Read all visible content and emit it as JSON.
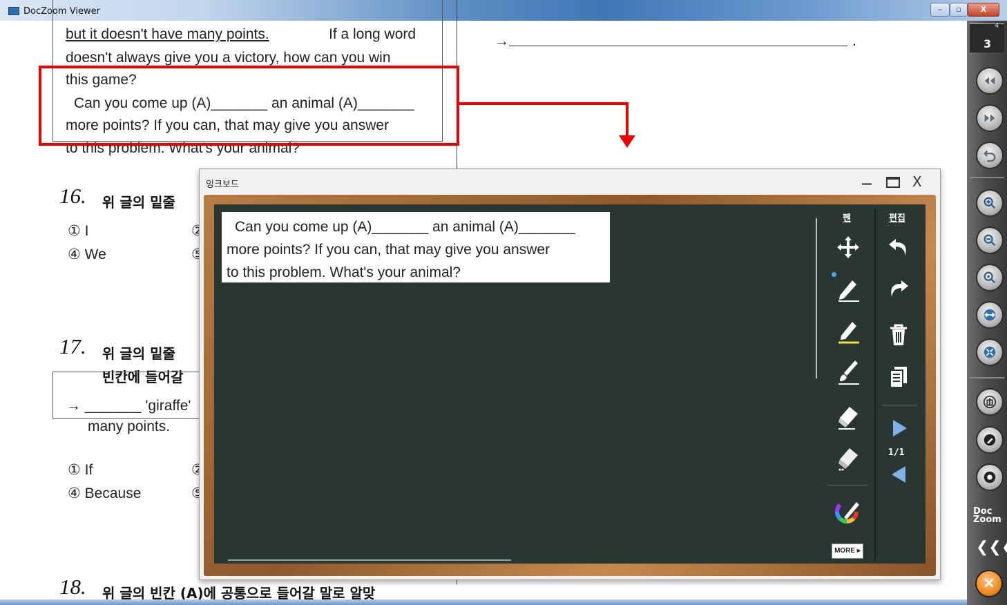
{
  "window": {
    "title": "DocZoom Viewer",
    "min": "▭",
    "max": "◻",
    "close": "X"
  },
  "document": {
    "passage_lines": [
      "but  it  doesn't  have  many  points.",
      "doesn't  always  give  you  a  victory,  how  can  you  win",
      "this  game?",
      "Can  you  come  up  (A)_______  an  animal  (A)_______",
      "more  points?  If  you  can,  that  may  give  you  answer",
      "to  this  problem.  What's  your  animal?"
    ],
    "line1_tail": "If  a  long  word",
    "answer_arrow": "→",
    "answer_end": ".",
    "q16": {
      "number": "16.",
      "prompt": "위 글의 밑줄",
      "choice1": "① I",
      "choice4": "④ We",
      "partial2": "②",
      "partial5": "⑤"
    },
    "q17": {
      "number": "17.",
      "prompt": "위 글의 밑줄",
      "prompt2": "빈칸에 들어갈",
      "box_line1": "→ _______  'giraffe'",
      "box_line2": "many  points.",
      "choice1": "① If",
      "choice4": "④ Because",
      "partial2": "②",
      "partial5": "⑤"
    },
    "q18": {
      "number": "18.",
      "prompt": "위 글의 빈칸 (A)에 공통으로 들어갈 말로 알맞"
    }
  },
  "dock": {
    "page_number": "3",
    "page_top": "4",
    "logo_line1": "Doc",
    "logo_line2": "Zoom",
    "collapse": "«‹",
    "exit": "×"
  },
  "inkboard": {
    "title": "잉크보드",
    "minimize": "—",
    "close": "X",
    "snippet_lines": [
      "Can  you  come  up  (A)_______  an  animal  (A)_______",
      "more  points?  If  you  can,  that  may  give  you  answer",
      "to  this  problem.  What's  your  animal?"
    ],
    "pen_header": "펜",
    "edit_header": "편집",
    "page_counter": "1/1",
    "more_label": "MORE ▸"
  },
  "colors": {
    "highlight": "#e00000",
    "board": "#2a3632",
    "frame": "#a36a36"
  }
}
